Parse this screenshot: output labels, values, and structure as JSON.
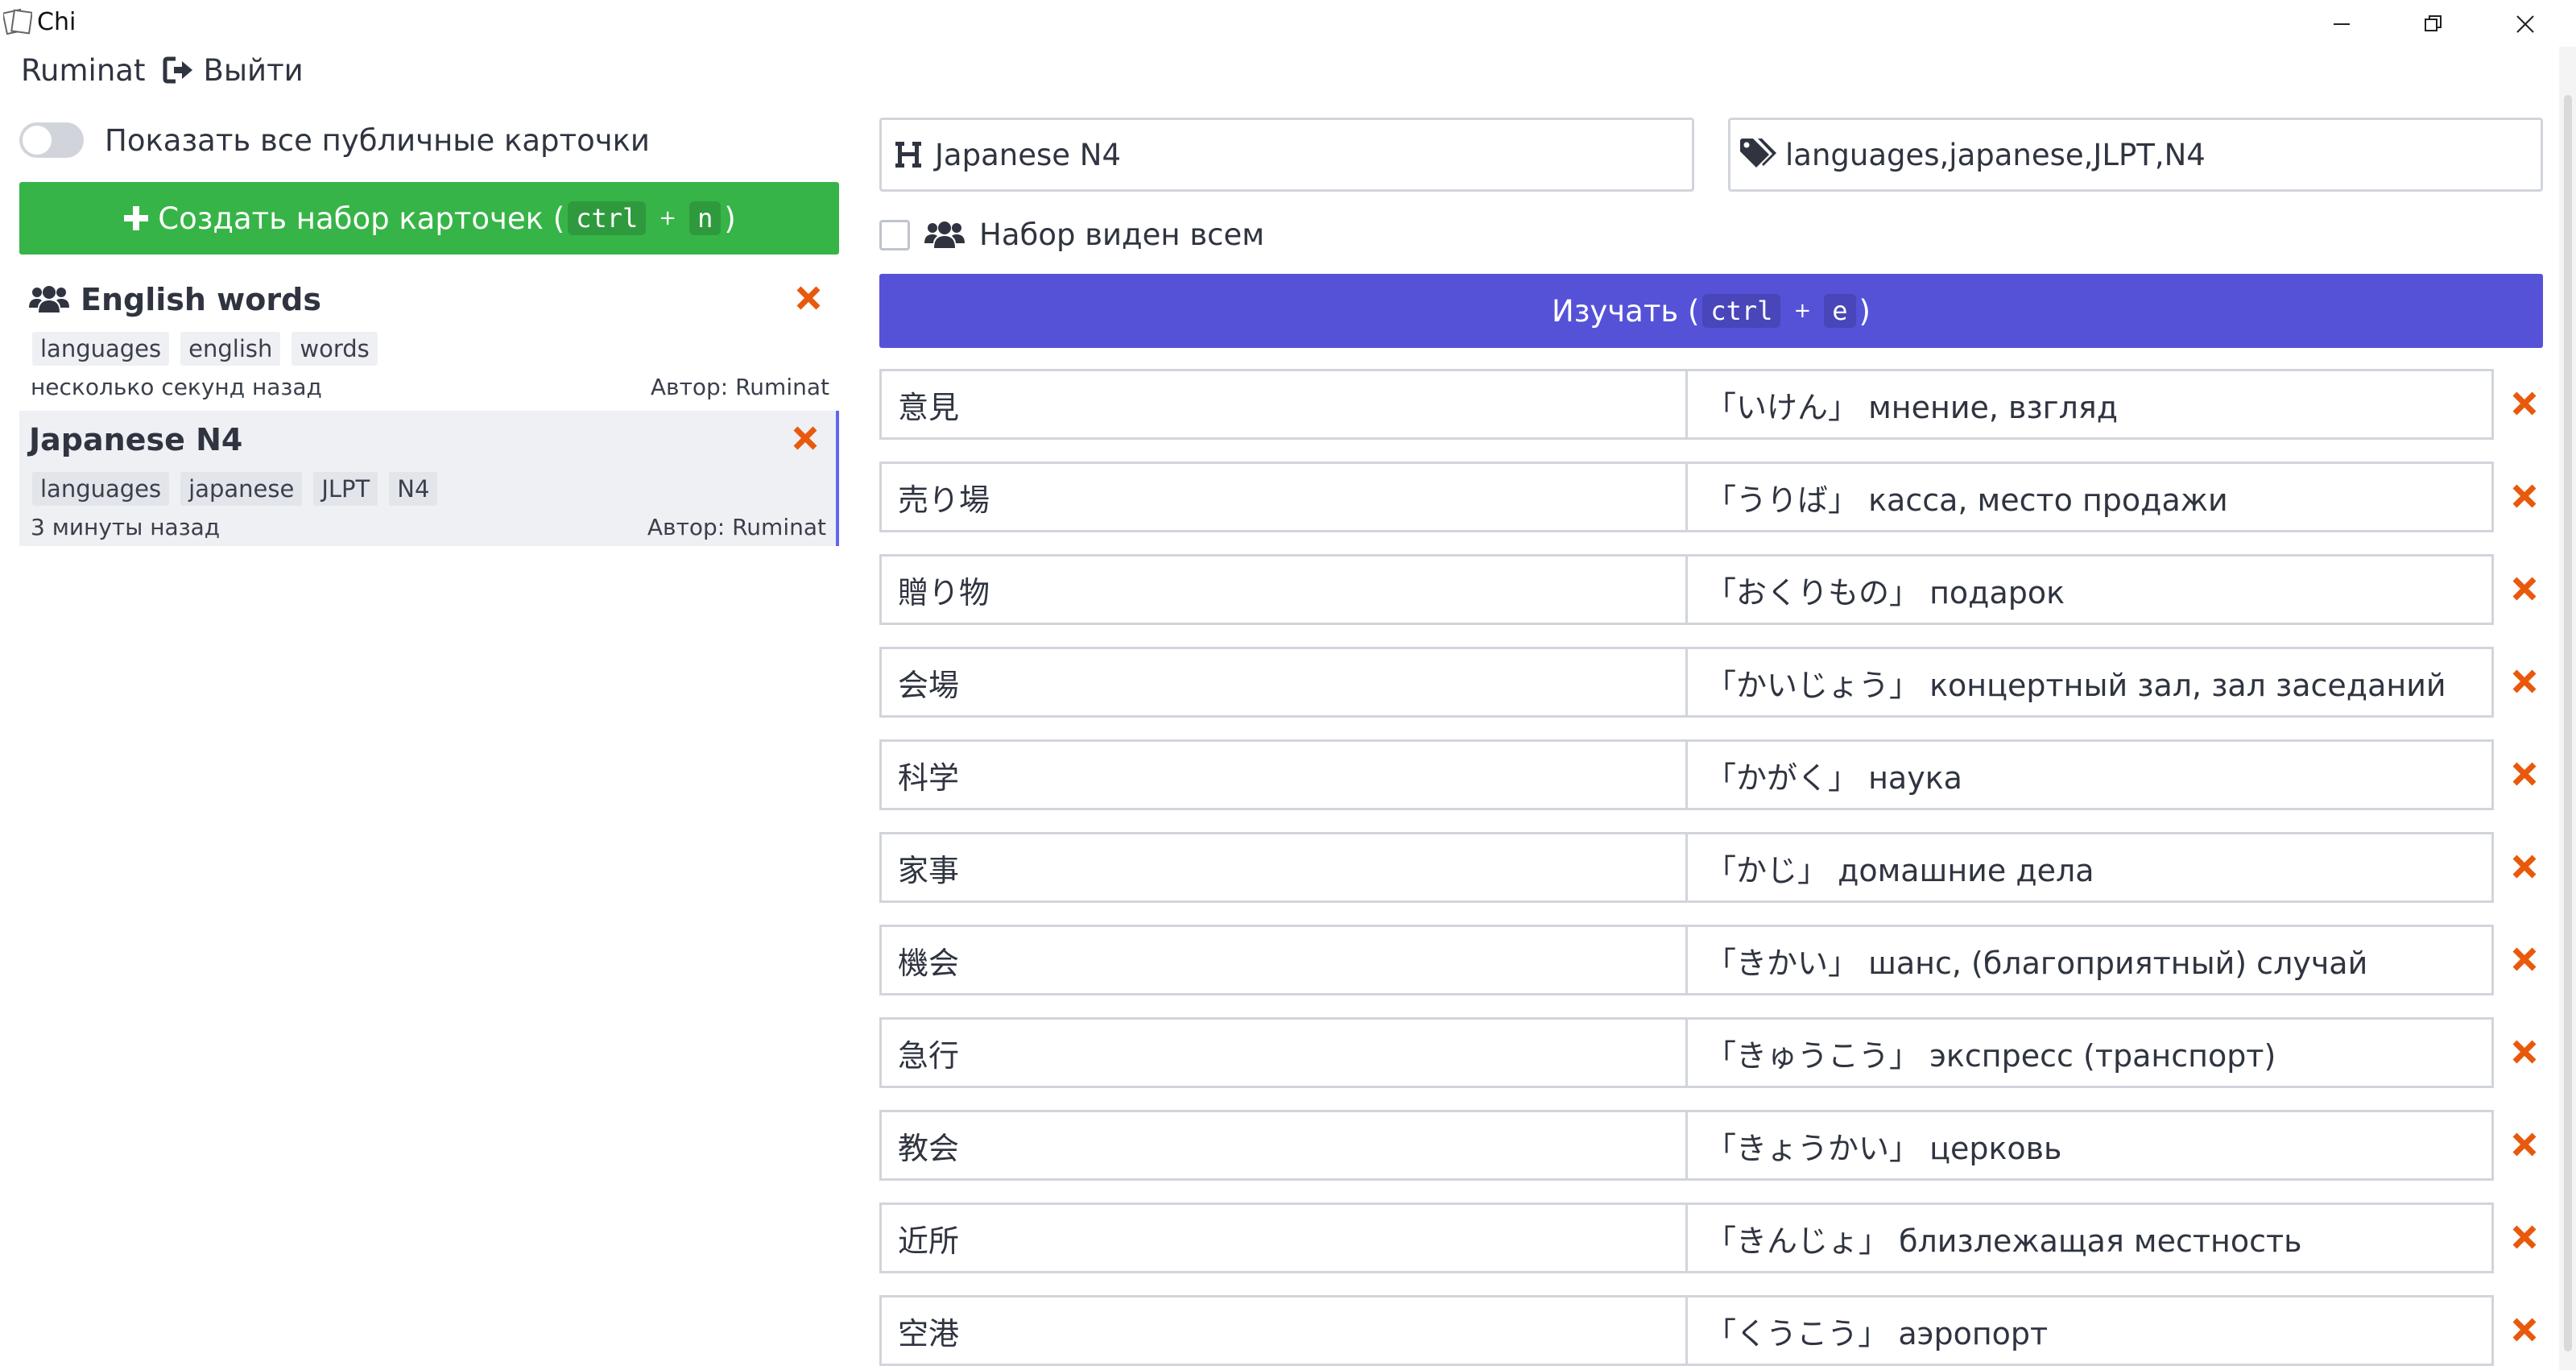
{
  "window": {
    "title": "Chi"
  },
  "user": {
    "name": "Ruminat",
    "logout_label": "Выйти"
  },
  "left": {
    "toggle_label": "Показать все публичные карточки",
    "create": {
      "label": "Создать набор карточек (",
      "key1": "ctrl",
      "plus": "+",
      "key2": "n",
      "close": ")"
    },
    "decks": [
      {
        "title": "English words",
        "tags": [
          "languages",
          "english",
          "words"
        ],
        "time": "несколько секунд назад",
        "author": "Автор: Ruminat"
      },
      {
        "title": "Japanese N4",
        "tags": [
          "languages",
          "japanese",
          "JLPT",
          "N4"
        ],
        "time": "3 минуты назад",
        "author": "Автор: Ruminat"
      }
    ]
  },
  "editor": {
    "name_value": "Japanese N4",
    "tags_value": "languages,japanese,JLPT,N4",
    "public_label": "Набор виден всем",
    "study": {
      "label": "Изучать (",
      "key1": "ctrl",
      "plus": "+",
      "key2": "e",
      "close": ")"
    },
    "cards": [
      {
        "front": "意見",
        "back": "「いけん」 мнение, взгляд"
      },
      {
        "front": "売り場",
        "back": "「うりば」 касса, место продажи"
      },
      {
        "front": "贈り物",
        "back": "「おくりもの」 подарок"
      },
      {
        "front": "会場",
        "back": "「かいじょう」 концертный зал, зал заседаний"
      },
      {
        "front": "科学",
        "back": "「かがく」 наука"
      },
      {
        "front": "家事",
        "back": "「かじ」 домашние дела"
      },
      {
        "front": "機会",
        "back": "「きかい」 шанс, (благоприятный) случай"
      },
      {
        "front": "急行",
        "back": "「きゅうこう」 экспресс (транспорт)"
      },
      {
        "front": "教会",
        "back": "「きょうかい」 церковь"
      },
      {
        "front": "近所",
        "back": "「きんじょ」 близлежащая местность"
      },
      {
        "front": "空港",
        "back": "「くうこう」 аэропорт"
      }
    ]
  },
  "colors": {
    "create": "#37b447",
    "study": "#5552d8",
    "delete": "#e8590c",
    "selected_border": "#6366f1"
  }
}
